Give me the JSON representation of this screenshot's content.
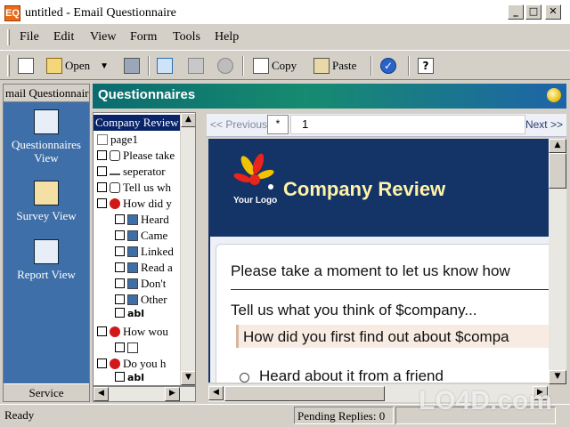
{
  "window": {
    "app_icon": "EQ",
    "title": "untitled - Email Questionnaire",
    "minimize_glyph": "_",
    "maximize_glyph": "□",
    "close_glyph": "✕"
  },
  "menu": [
    "File",
    "Edit",
    "View",
    "Form",
    "Tools",
    "Help"
  ],
  "toolbar": {
    "open_label": "Open",
    "copy_label": "Copy",
    "paste_label": "Paste",
    "help_glyph": "?"
  },
  "sidebar": {
    "header": "mail Questionnair",
    "items": [
      "Questionnaires View",
      "Survey View",
      "Report View"
    ],
    "footer": "Service"
  },
  "banner": {
    "title": "Questionnaires"
  },
  "tree": {
    "root": "Company Review",
    "rows": [
      "page1",
      "Please take",
      "seperator",
      "Tell us wh",
      "How did y",
      "Heard",
      "Came",
      "Linked",
      "Read a",
      "Don't",
      "Other",
      "abl",
      "How wou",
      "",
      "Do you h",
      "abl"
    ]
  },
  "pagebar": {
    "prev": "<< Previous",
    "marker": "*",
    "page_value": "1",
    "next": "Next >>"
  },
  "preview": {
    "logo_text": "Your Logo",
    "company_title": "Company Review",
    "q1": "Please take a moment to let us know how",
    "q2": "Tell us what you think of $company...",
    "q3": "How did you first find out about $compa",
    "option1": "Heard about it from a friend"
  },
  "status": {
    "left": "Ready",
    "pending": "Pending Replies: 0"
  },
  "watermark": "LO4D.com",
  "colors": {
    "sidebar_bg": "#3f6fa8",
    "banner_start": "#0b6b70",
    "banner_end": "#1e64a8",
    "preview_header": "#143366",
    "title_accent": "#fff3a8"
  }
}
